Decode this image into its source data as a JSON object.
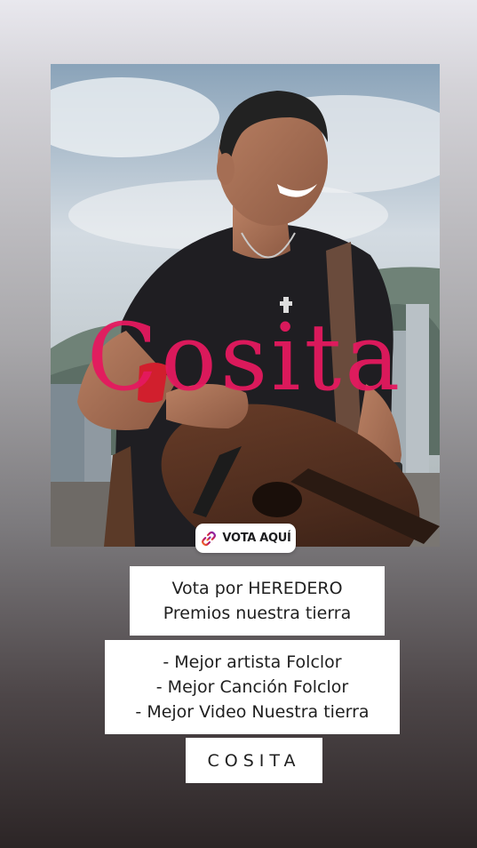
{
  "post": {
    "overlay_title": "Cosita",
    "sticker": {
      "label": "VOTA AQUÍ",
      "icon": "link-icon"
    },
    "caption_lines": [
      "Vota por HEREDERO",
      "Premios nuestra tierra"
    ],
    "categories": [
      "- Mejor artista Folclor",
      "- Mejor Canción Folclor",
      "- Mejor Video Nuestra tierra"
    ],
    "song_label": "COSITA"
  },
  "colors": {
    "title_pink": "#e5195f",
    "sticker_icon_gradient": [
      "#ff7a18",
      "#c2195d",
      "#7b2cbf"
    ],
    "background_top": "#e9e8ee",
    "background_bottom": "#2c2526"
  }
}
